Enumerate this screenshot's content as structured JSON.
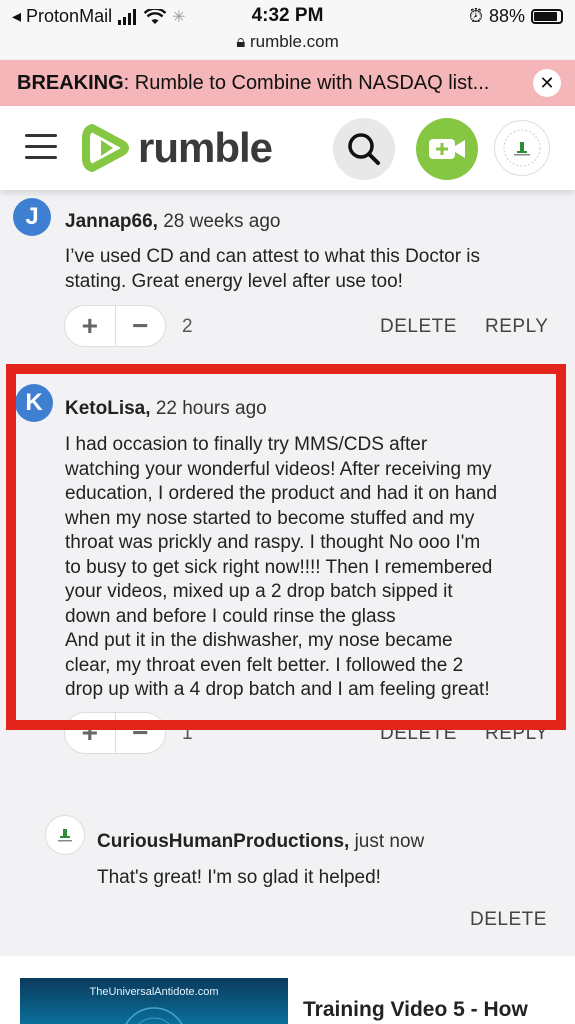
{
  "status_bar": {
    "carrier": "◂ ProtonMail",
    "time": "4:32 PM",
    "url": "rumble.com",
    "battery": "88%",
    "battery_level": 0.88
  },
  "breaking": {
    "label": "BREAKING",
    "text": ": Rumble to Combine with NASDAQ list...",
    "close": "✕"
  },
  "header": {
    "logo_text": "rumble",
    "icons": [
      "hamburger-icon",
      "search-icon",
      "upload-video-icon",
      "profile-avatar"
    ]
  },
  "comments": [
    {
      "initial": "J",
      "author": "Jannap66,",
      "time": "28 weeks ago",
      "text": "I’ve used CD and can attest to what this Doctor is stating. Great energy level after use too!",
      "count": "2",
      "delete": "DELETE",
      "reply": "REPLY"
    },
    {
      "initial": "K",
      "author": "KetoLisa,",
      "time": "22 hours ago",
      "lines": [
        "I had occasion to finally try MMS/CDS after",
        "watching your wonderful videos! After receiving my",
        "education, I ordered the product and had it on hand",
        "when my nose started to become stuffed and my",
        "throat was prickly and raspy. I thought No ooo I'm",
        "to busy to get sick right now!!!! Then I remembered",
        "your videos, mixed up a 2 drop batch sipped it",
        "down and before I could rinse the glass",
        "And put it in the dishwasher, my nose became",
        "clear, my throat even felt better. I followed the 2",
        "drop up with a 4 drop batch and I am feeling great!"
      ],
      "count": "1",
      "delete": "DELETE",
      "reply": "REPLY"
    }
  ],
  "reply": {
    "author": "CuriousHumanProductions,",
    "time": "just now",
    "text": "That's great! I'm so glad it helped!",
    "delete": "DELETE"
  },
  "video": {
    "thumb_text": "TheUniversalAntidote.com",
    "title": "Training Video 5 - How"
  },
  "colors": {
    "accent_green": "#85c742",
    "avatar_blue": "#3f7fd1",
    "highlight_red": "#e2241a",
    "breaking_bg": "#f4b6b8"
  }
}
